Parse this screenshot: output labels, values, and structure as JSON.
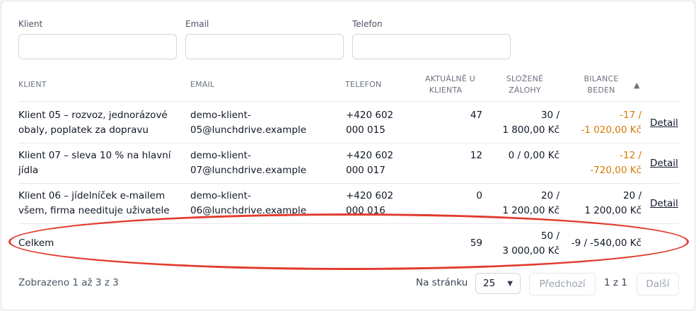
{
  "filters": {
    "client_label": "Klient",
    "email_label": "Email",
    "phone_label": "Telefon",
    "client_value": "",
    "email_value": "",
    "phone_value": ""
  },
  "table": {
    "headers": {
      "client": "KLIENT",
      "email": "EMAIL",
      "phone": "TELEFON",
      "current_l1": "AKTUÁLNĚ U",
      "current_l2": "KLIENTA",
      "deposits_l1": "SLOŽENÉ",
      "deposits_l2": "ZÁLOHY",
      "balance_l1": "BILANCE",
      "balance_l2": "BEDEN",
      "sort_indicator": "▲"
    },
    "rows": [
      {
        "client_l1": "Klient 05 – rozvoz, jednorázové",
        "client_l2": "obaly, poplatek za dopravu",
        "email_l1": "demo-klient-",
        "email_l2": "05@lunchdrive.example",
        "phone_l1": "+420 602",
        "phone_l2": "000 015",
        "current": "47",
        "deposits_l1": "30 /",
        "deposits_l2": "1 800,00 Kč",
        "balance_l1": "-17 /",
        "balance_l2": "-1 020,00 Kč",
        "balance_negative": true,
        "action": "Detail"
      },
      {
        "client_l1": "Klient 07 – sleva 10 % na hlavní",
        "client_l2": "jídla",
        "email_l1": "demo-klient-",
        "email_l2": "07@lunchdrive.example",
        "phone_l1": "+420 602",
        "phone_l2": "000 017",
        "current": "12",
        "deposits_l1": "0 / 0,00 Kč",
        "deposits_l2": "",
        "balance_l1": "-12 /",
        "balance_l2": "-720,00 Kč",
        "balance_negative": true,
        "action": "Detail"
      },
      {
        "client_l1": "Klient 06 – jídelníček e-mailem",
        "client_l2": "všem, firma needituje uživatele",
        "email_l1": "demo-klient-",
        "email_l2": "06@lunchdrive.example",
        "phone_l1": "+420 602",
        "phone_l2": "000 016",
        "current": "0",
        "deposits_l1": "20 /",
        "deposits_l2": "1 200,00 Kč",
        "balance_l1": "20 /",
        "balance_l2": "1 200,00 Kč",
        "balance_negative": false,
        "action": "Detail"
      }
    ],
    "totals": {
      "label": "Celkem",
      "current": "59",
      "deposits_l1": "50 /",
      "deposits_l2": "3 000,00 Kč",
      "balance": "-9 / -540,00 Kč"
    }
  },
  "pagination": {
    "info": "Zobrazeno 1 až 3 z 3",
    "per_page_label": "Na stránku",
    "per_page_value": "25",
    "prev_label": "Předchozí",
    "page_indicator": "1 z 1",
    "next_label": "Další"
  },
  "colors": {
    "negative": "#d97706",
    "highlight_ellipse": "#e23b2e"
  }
}
